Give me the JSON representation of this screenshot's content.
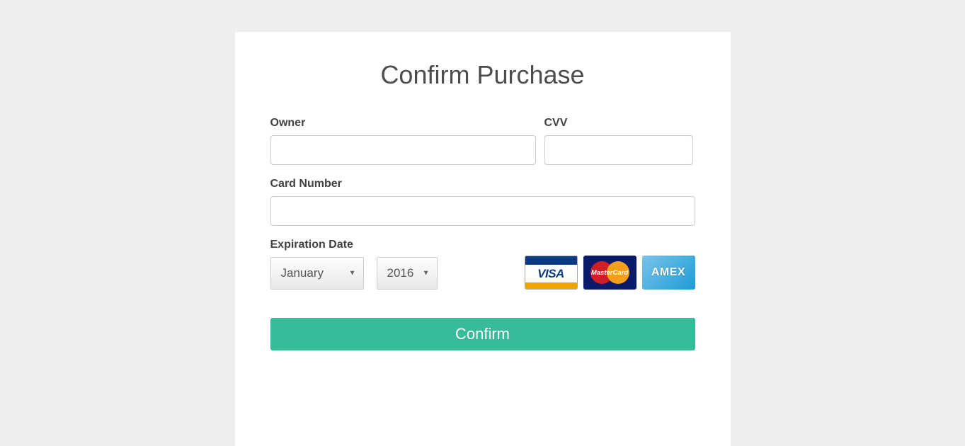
{
  "heading": "Confirm Purchase",
  "labels": {
    "owner": "Owner",
    "cvv": "CVV",
    "card_number": "Card Number",
    "expiration": "Expiration Date"
  },
  "fields": {
    "owner": "",
    "cvv": "",
    "card_number": ""
  },
  "expiration": {
    "month_selected": "January",
    "year_selected": "2016"
  },
  "card_brands": {
    "visa": "VISA",
    "mastercard": "MasterCard",
    "amex": "AMEX"
  },
  "actions": {
    "confirm": "Confirm"
  }
}
